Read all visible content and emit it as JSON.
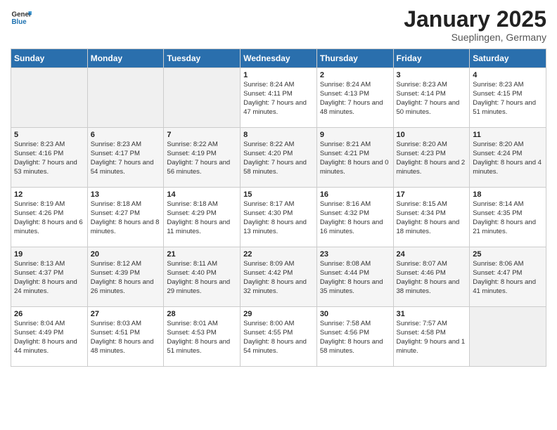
{
  "logo": {
    "text_general": "General",
    "text_blue": "Blue"
  },
  "title": {
    "month": "January 2025",
    "location": "Sueplingen, Germany"
  },
  "weekdays": [
    "Sunday",
    "Monday",
    "Tuesday",
    "Wednesday",
    "Thursday",
    "Friday",
    "Saturday"
  ],
  "weeks": [
    [
      {
        "day": "",
        "info": ""
      },
      {
        "day": "",
        "info": ""
      },
      {
        "day": "",
        "info": ""
      },
      {
        "day": "1",
        "info": "Sunrise: 8:24 AM\nSunset: 4:11 PM\nDaylight: 7 hours\nand 47 minutes."
      },
      {
        "day": "2",
        "info": "Sunrise: 8:24 AM\nSunset: 4:13 PM\nDaylight: 7 hours\nand 48 minutes."
      },
      {
        "day": "3",
        "info": "Sunrise: 8:23 AM\nSunset: 4:14 PM\nDaylight: 7 hours\nand 50 minutes."
      },
      {
        "day": "4",
        "info": "Sunrise: 8:23 AM\nSunset: 4:15 PM\nDaylight: 7 hours\nand 51 minutes."
      }
    ],
    [
      {
        "day": "5",
        "info": "Sunrise: 8:23 AM\nSunset: 4:16 PM\nDaylight: 7 hours\nand 53 minutes."
      },
      {
        "day": "6",
        "info": "Sunrise: 8:23 AM\nSunset: 4:17 PM\nDaylight: 7 hours\nand 54 minutes."
      },
      {
        "day": "7",
        "info": "Sunrise: 8:22 AM\nSunset: 4:19 PM\nDaylight: 7 hours\nand 56 minutes."
      },
      {
        "day": "8",
        "info": "Sunrise: 8:22 AM\nSunset: 4:20 PM\nDaylight: 7 hours\nand 58 minutes."
      },
      {
        "day": "9",
        "info": "Sunrise: 8:21 AM\nSunset: 4:21 PM\nDaylight: 8 hours\nand 0 minutes."
      },
      {
        "day": "10",
        "info": "Sunrise: 8:20 AM\nSunset: 4:23 PM\nDaylight: 8 hours\nand 2 minutes."
      },
      {
        "day": "11",
        "info": "Sunrise: 8:20 AM\nSunset: 4:24 PM\nDaylight: 8 hours\nand 4 minutes."
      }
    ],
    [
      {
        "day": "12",
        "info": "Sunrise: 8:19 AM\nSunset: 4:26 PM\nDaylight: 8 hours\nand 6 minutes."
      },
      {
        "day": "13",
        "info": "Sunrise: 8:18 AM\nSunset: 4:27 PM\nDaylight: 8 hours\nand 8 minutes."
      },
      {
        "day": "14",
        "info": "Sunrise: 8:18 AM\nSunset: 4:29 PM\nDaylight: 8 hours\nand 11 minutes."
      },
      {
        "day": "15",
        "info": "Sunrise: 8:17 AM\nSunset: 4:30 PM\nDaylight: 8 hours\nand 13 minutes."
      },
      {
        "day": "16",
        "info": "Sunrise: 8:16 AM\nSunset: 4:32 PM\nDaylight: 8 hours\nand 16 minutes."
      },
      {
        "day": "17",
        "info": "Sunrise: 8:15 AM\nSunset: 4:34 PM\nDaylight: 8 hours\nand 18 minutes."
      },
      {
        "day": "18",
        "info": "Sunrise: 8:14 AM\nSunset: 4:35 PM\nDaylight: 8 hours\nand 21 minutes."
      }
    ],
    [
      {
        "day": "19",
        "info": "Sunrise: 8:13 AM\nSunset: 4:37 PM\nDaylight: 8 hours\nand 24 minutes."
      },
      {
        "day": "20",
        "info": "Sunrise: 8:12 AM\nSunset: 4:39 PM\nDaylight: 8 hours\nand 26 minutes."
      },
      {
        "day": "21",
        "info": "Sunrise: 8:11 AM\nSunset: 4:40 PM\nDaylight: 8 hours\nand 29 minutes."
      },
      {
        "day": "22",
        "info": "Sunrise: 8:09 AM\nSunset: 4:42 PM\nDaylight: 8 hours\nand 32 minutes."
      },
      {
        "day": "23",
        "info": "Sunrise: 8:08 AM\nSunset: 4:44 PM\nDaylight: 8 hours\nand 35 minutes."
      },
      {
        "day": "24",
        "info": "Sunrise: 8:07 AM\nSunset: 4:46 PM\nDaylight: 8 hours\nand 38 minutes."
      },
      {
        "day": "25",
        "info": "Sunrise: 8:06 AM\nSunset: 4:47 PM\nDaylight: 8 hours\nand 41 minutes."
      }
    ],
    [
      {
        "day": "26",
        "info": "Sunrise: 8:04 AM\nSunset: 4:49 PM\nDaylight: 8 hours\nand 44 minutes."
      },
      {
        "day": "27",
        "info": "Sunrise: 8:03 AM\nSunset: 4:51 PM\nDaylight: 8 hours\nand 48 minutes."
      },
      {
        "day": "28",
        "info": "Sunrise: 8:01 AM\nSunset: 4:53 PM\nDaylight: 8 hours\nand 51 minutes."
      },
      {
        "day": "29",
        "info": "Sunrise: 8:00 AM\nSunset: 4:55 PM\nDaylight: 8 hours\nand 54 minutes."
      },
      {
        "day": "30",
        "info": "Sunrise: 7:58 AM\nSunset: 4:56 PM\nDaylight: 8 hours\nand 58 minutes."
      },
      {
        "day": "31",
        "info": "Sunrise: 7:57 AM\nSunset: 4:58 PM\nDaylight: 9 hours\nand 1 minute."
      },
      {
        "day": "",
        "info": ""
      }
    ]
  ]
}
